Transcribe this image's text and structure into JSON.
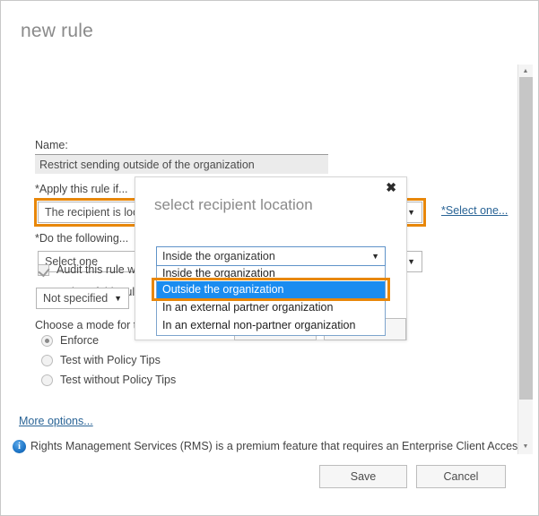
{
  "page": {
    "title": "new rule"
  },
  "form": {
    "name_label": "Name:",
    "name_value": "Restrict sending outside of the organization",
    "name_placeholder": "",
    "apply_label": "*Apply this rule if...",
    "apply_value": "The recipient is located...",
    "apply_select_link": "*Select one...",
    "do_label": "*Do the following...",
    "do_value": "Select one",
    "properties_label": "Properties of this rule:",
    "audit_label": "Audit this rule with severity level:",
    "audit_checked": true,
    "severity_value": "Not specified",
    "mode_label": "Choose a mode for this rule:",
    "modes": [
      {
        "label": "Enforce",
        "selected": true
      },
      {
        "label": "Test with Policy Tips",
        "selected": false
      },
      {
        "label": "Test without Policy Tips",
        "selected": false
      }
    ],
    "more_options_link": "More options..."
  },
  "info": {
    "icon": "info-icon",
    "text": "Rights Management Services (RMS) is a premium feature that requires an Enterprise Client Access"
  },
  "footer": {
    "save_label": "Save",
    "cancel_label": "Cancel"
  },
  "scrollbar": {
    "up_icon": "triangle-up-icon",
    "down_icon": "triangle-down-icon"
  },
  "modal": {
    "title": "select recipient location",
    "close_icon": "close-icon",
    "selected_value": "Inside the organization",
    "dropdown_arrow": "chevron-down-icon",
    "options": [
      {
        "label": "Inside the organization",
        "selected": false
      },
      {
        "label": "Outside the organization",
        "selected": true
      },
      {
        "label": "In an external partner organization",
        "selected": false
      },
      {
        "label": "In an external non-partner organization",
        "selected": false
      }
    ],
    "ok_label": "",
    "cancel_label": ""
  },
  "colors": {
    "highlight": "#e8870a",
    "selection": "#1a8cf0",
    "link": "#2a6496",
    "info": "#1e76c8"
  }
}
